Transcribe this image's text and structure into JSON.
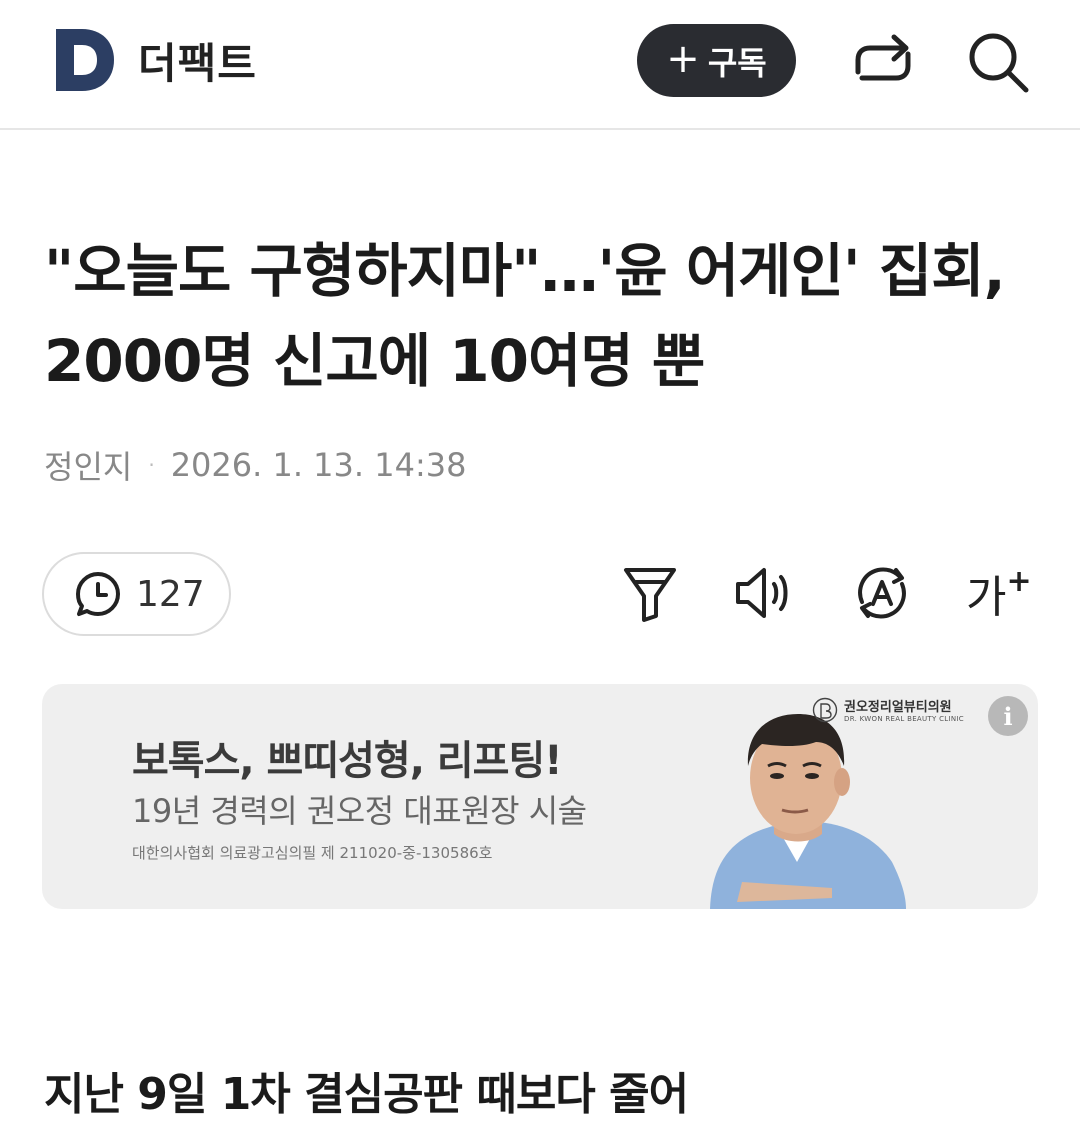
{
  "header": {
    "brand_name": "더팩트",
    "logo_letter": "D",
    "subscribe_label": "구독",
    "subscribe_plus": "+",
    "colors": {
      "logo": "#2c3e63",
      "subscribe_bg": "#2a2c31"
    },
    "icons": [
      "share-icon",
      "search-icon"
    ]
  },
  "article": {
    "headline": "\"오늘도 구형하지마\"…'윤 어게인' 집회, 2000명 신고에 10여명 뿐",
    "author": "정인지",
    "separator": "·",
    "date": "2026. 1. 13. 14:38",
    "subheading": "지난 9일 1차 결심공판 때보다 줄어"
  },
  "toolbar": {
    "comment_count": "127",
    "font_size_label": "가",
    "font_size_plus": "+",
    "icons": [
      "comment-icon",
      "filter-icon",
      "audio-icon",
      "translate-icon",
      "font-size-icon"
    ]
  },
  "ad": {
    "title": "보톡스, 쁘띠성형, 리프팅!",
    "subtitle": "19년 경력의 권오정 대표원장 시술",
    "notice": "대한의사협회 의료광고심의필 제 211020-중-130586호",
    "clinic_name_kr": "권오정리얼뷰티의원",
    "clinic_name_en": "DR. KWON REAL BEAUTY CLINIC",
    "info_label": "i",
    "background": "#efefef"
  }
}
